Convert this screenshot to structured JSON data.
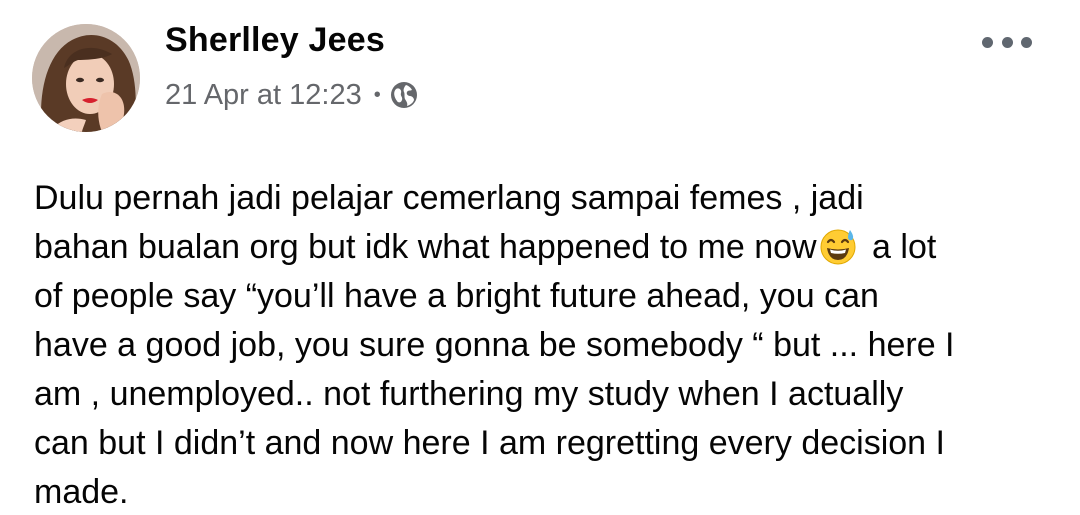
{
  "post": {
    "author": "Sherlley Jees",
    "timestamp": "21 Apr at 12:23",
    "separator": "•",
    "privacy_icon": "globe-icon",
    "menu_icon": "more-options-icon",
    "body_lines": [
      "Dulu pernah jadi pelajar cemerlang sampai femes , jadi",
      "bahan bualan org but idk what happened to me now",
      " a lot",
      "of people say “you’ll have a bright future ahead, you can",
      "have a good job, you sure gonna be somebody “ but ... here I",
      "am , unemployed.. not furthering my study when I actually",
      "can but I didn’t and now here I am regretting every decision I",
      "made."
    ],
    "emoji": "grinning-face-with-sweat-emoji"
  },
  "colors": {
    "text": "#050505",
    "secondary_text": "#65676b",
    "icon": "#606770",
    "emoji_face": "#ffcc33",
    "emoji_sweat": "#5bb6e8"
  }
}
